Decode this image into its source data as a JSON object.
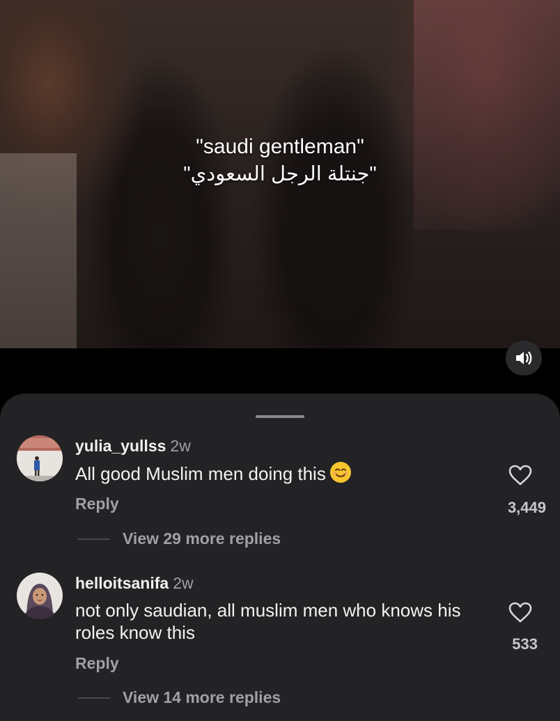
{
  "video": {
    "caption_en": "\"saudi gentleman\"",
    "caption_ar": "\"جنتلة الرجل السعودي\"",
    "sound_icon": "speaker-icon"
  },
  "comments": [
    {
      "username": "yulia_yullss",
      "time": "2w",
      "text": "All good Muslim men doing this",
      "emoji": "😊",
      "reply_label": "Reply",
      "likes": "3,449",
      "view_replies": "View 29 more replies"
    },
    {
      "username": "helloitsanifa",
      "time": "2w",
      "text": "not only saudian, all muslim men who knows his roles know this",
      "reply_label": "Reply",
      "likes": "533",
      "view_replies": "View 14 more replies"
    }
  ],
  "colors": {
    "sheet_bg": "#232326",
    "muted_text": "#a0a0a5",
    "page_bg": "#000000"
  }
}
